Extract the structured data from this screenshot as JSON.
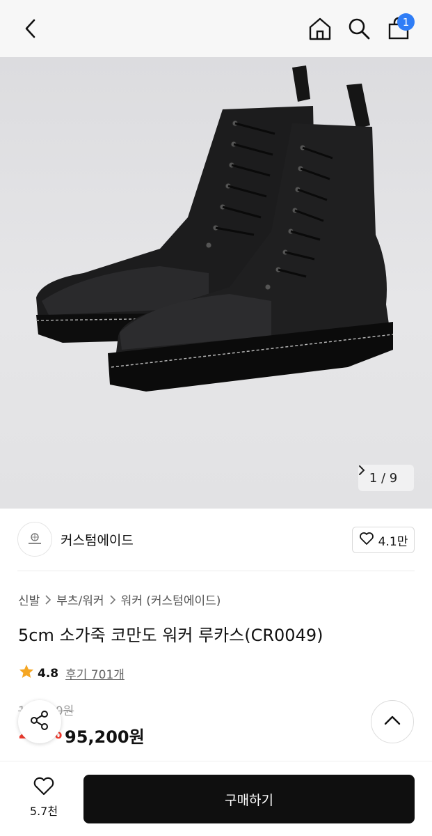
{
  "header": {
    "back_icon": "chevron-left-icon",
    "home_icon": "home-icon",
    "search_icon": "search-icon",
    "cart_icon": "shopping-bag-icon",
    "cart_badge": "1",
    "badge_color": "#2f7df6"
  },
  "gallery": {
    "current": "1",
    "separator": "/",
    "total": "9",
    "next_icon": "chevron-right-icon"
  },
  "brand": {
    "name": "커스텀에이드",
    "logo_icon": "brand-logo-icon",
    "like_icon": "heart-outline-icon",
    "like_count": "4.1만"
  },
  "breadcrumb": {
    "items": [
      "신발",
      "부츠/워커",
      "워커 (커스텀에이드)"
    ],
    "separator_icon": "chevron-right-icon"
  },
  "product": {
    "title": "5cm 소가죽 코만도 워커 루카스(CR0049)",
    "rating": "4.8",
    "reviews": "후기 701개",
    "star_color": "#f5a623",
    "original_price": "1■■00원",
    "discount": "2■%",
    "sale_price": "95,200원",
    "discount_color": "#f03a2e"
  },
  "floating": {
    "share_icon": "share-icon",
    "scroll_top_icon": "chevron-up-icon"
  },
  "bottom_bar": {
    "wish_icon": "heart-outline-icon",
    "wish_count": "5.7천",
    "buy_label": "구매하기"
  }
}
